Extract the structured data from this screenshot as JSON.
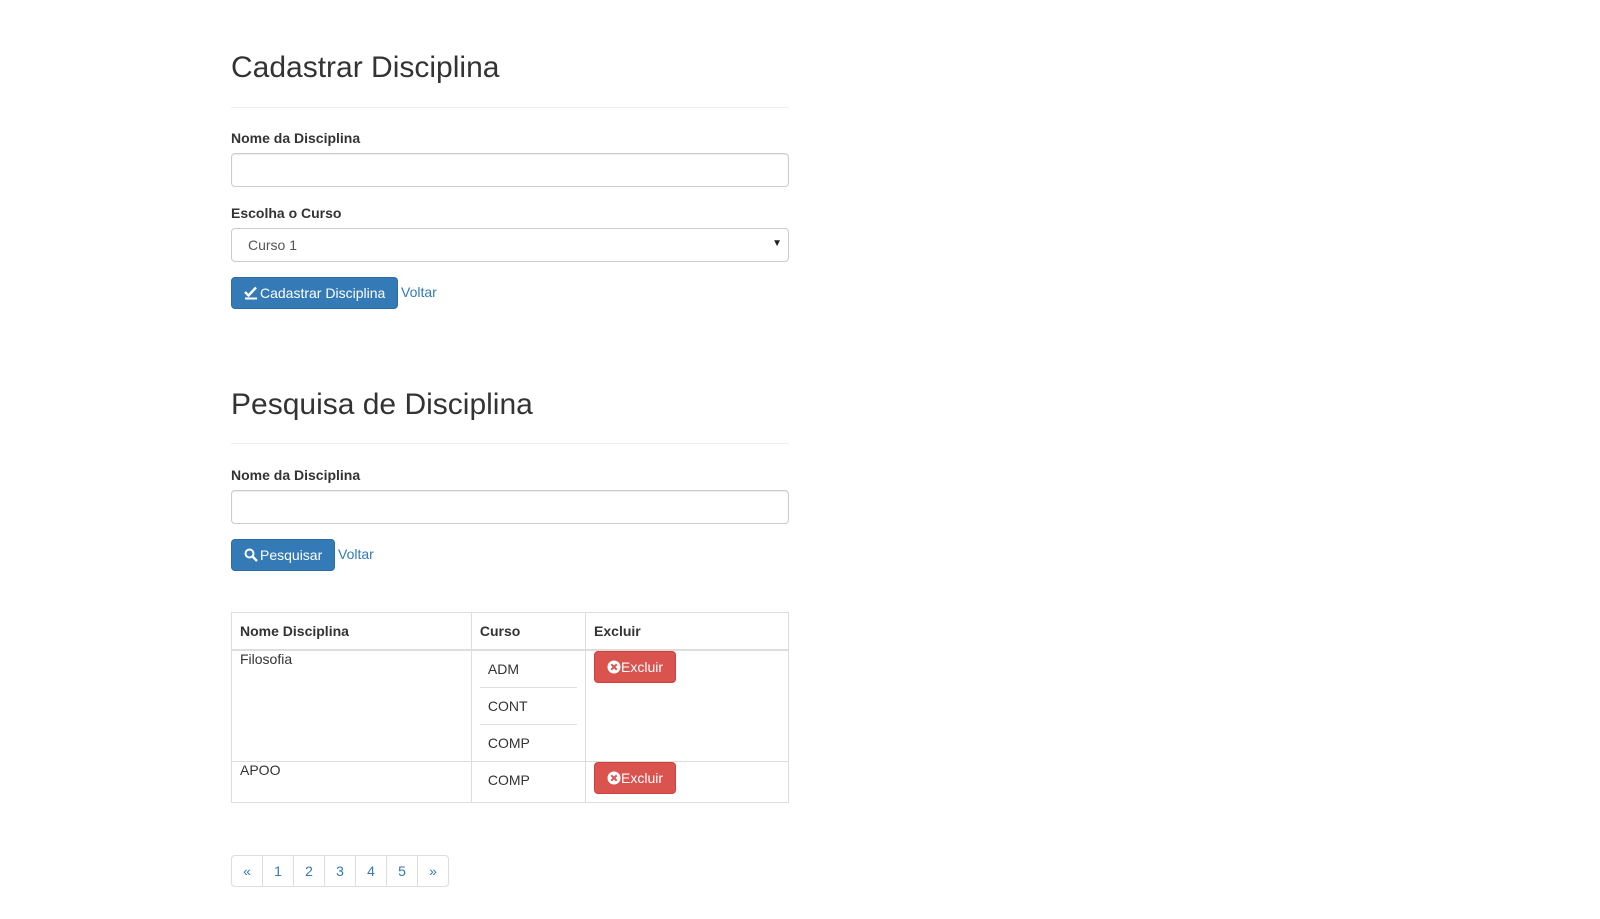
{
  "register": {
    "title": "Cadastrar Disciplina",
    "name_label": "Nome da Disciplina",
    "name_value": "",
    "course_label": "Escolha o Curso",
    "course_selected": "Curso 1",
    "submit_label": "Cadastrar Disciplina",
    "back_label": "Voltar"
  },
  "search": {
    "title": "Pesquisa de Disciplina",
    "name_label": "Nome da Disciplina",
    "name_value": "",
    "submit_label": "Pesquisar",
    "back_label": "Voltar"
  },
  "table": {
    "headers": [
      "Nome Disciplina",
      "Curso",
      "Excluir"
    ],
    "rows": [
      {
        "name": "Filosofia",
        "courses": [
          "ADM",
          "CONT",
          "COMP"
        ],
        "action": "Excluir"
      },
      {
        "name": "APOO",
        "courses": [
          "COMP"
        ],
        "action": "Excluir"
      }
    ]
  },
  "pagination": {
    "prev": "«",
    "pages": [
      "1",
      "2",
      "3",
      "4",
      "5"
    ],
    "next": "»"
  },
  "colors": {
    "primary": "#337ab7",
    "danger": "#d9534f"
  },
  "icons": {
    "register_button": "check-icon",
    "search_button": "search-icon",
    "delete_button": "remove-circle-icon",
    "select": "caret-down-icon"
  }
}
